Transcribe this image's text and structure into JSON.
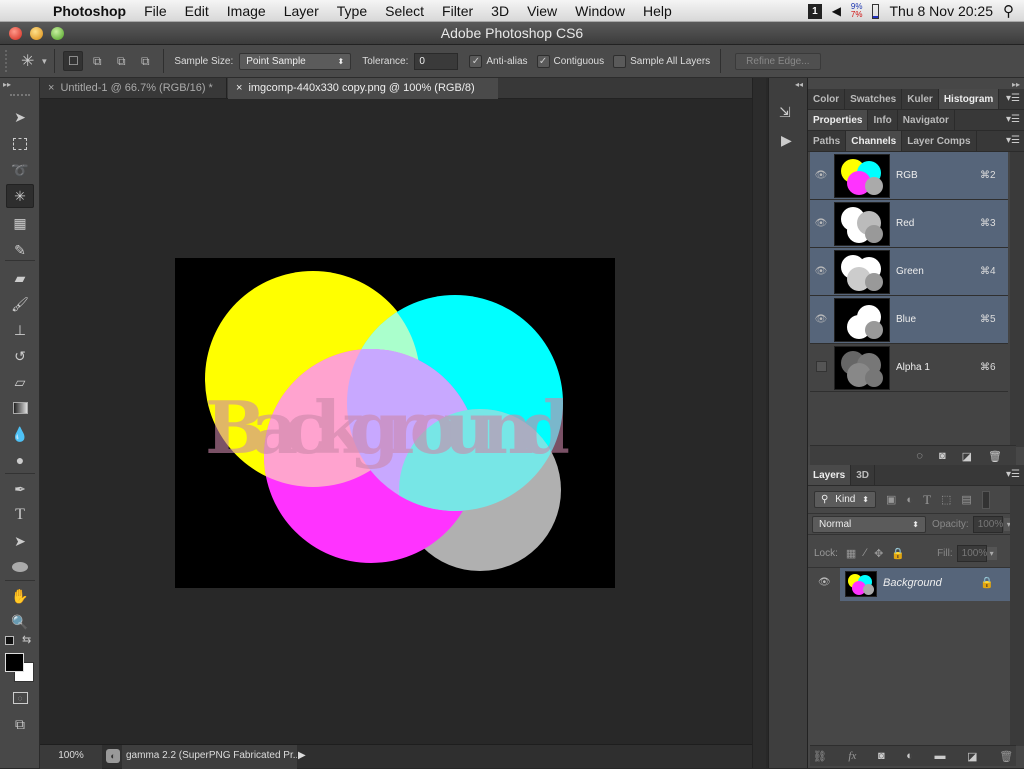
{
  "menubar": {
    "app_name": "Photoshop",
    "items": [
      "File",
      "Edit",
      "Image",
      "Layer",
      "Type",
      "Select",
      "Filter",
      "3D",
      "View",
      "Window",
      "Help"
    ],
    "status_badge": "1",
    "cpu_top": "9%",
    "cpu_bottom": "7%",
    "clock": "Thu 8 Nov  20:25"
  },
  "window": {
    "title": "Adobe Photoshop CS6"
  },
  "options": {
    "sample_size_label": "Sample Size:",
    "sample_size_value": "Point Sample",
    "tolerance_label": "Tolerance:",
    "tolerance_value": "0",
    "anti_alias_label": "Anti-alias",
    "anti_alias_checked": true,
    "contiguous_label": "Contiguous",
    "contiguous_checked": true,
    "sample_all_label": "Sample All Layers",
    "sample_all_checked": false,
    "refine_edge_label": "Refine Edge..."
  },
  "tabs": [
    {
      "label": "Untitled-1 @ 66.7% (RGB/16) *",
      "active": false
    },
    {
      "label": "imgcomp-440x330 copy.png @ 100% (RGB/8)",
      "active": true
    }
  ],
  "canvas": {
    "text": "Background"
  },
  "statusbar": {
    "zoom": "100%",
    "profile": "gamma 2.2 (SuperPNG Fabricated Pr..."
  },
  "panels": {
    "group1_tabs": [
      "Color",
      "Swatches",
      "Kuler",
      "Histogram"
    ],
    "group1_active": "Histogram",
    "group2_tabs": [
      "Properties",
      "Info",
      "Navigator"
    ],
    "group2_active": "Properties",
    "group3_tabs": [
      "Paths",
      "Channels",
      "Layer Comps"
    ],
    "group3_active": "Channels",
    "channels": [
      {
        "name": "RGB",
        "shortcut": "⌘2",
        "visible": true
      },
      {
        "name": "Red",
        "shortcut": "⌘3",
        "visible": true
      },
      {
        "name": "Green",
        "shortcut": "⌘4",
        "visible": true
      },
      {
        "name": "Blue",
        "shortcut": "⌘5",
        "visible": true
      },
      {
        "name": "Alpha 1",
        "shortcut": "⌘6",
        "visible": false
      }
    ],
    "layers_tabs": [
      "Layers",
      "3D"
    ],
    "layers_active": "Layers",
    "filter_kind": "Kind",
    "blend_mode": "Normal",
    "opacity_label": "Opacity:",
    "opacity_value": "100%",
    "lock_label": "Lock:",
    "fill_label": "Fill:",
    "fill_value": "100%",
    "layers": [
      {
        "name": "Background",
        "locked": true,
        "visible": true
      }
    ]
  },
  "colors": {
    "selection": "#56657a",
    "yellow": "#ffff00",
    "cyan": "#00ffff",
    "magenta": "#ff33ff",
    "gray": "#b0b0b0"
  }
}
